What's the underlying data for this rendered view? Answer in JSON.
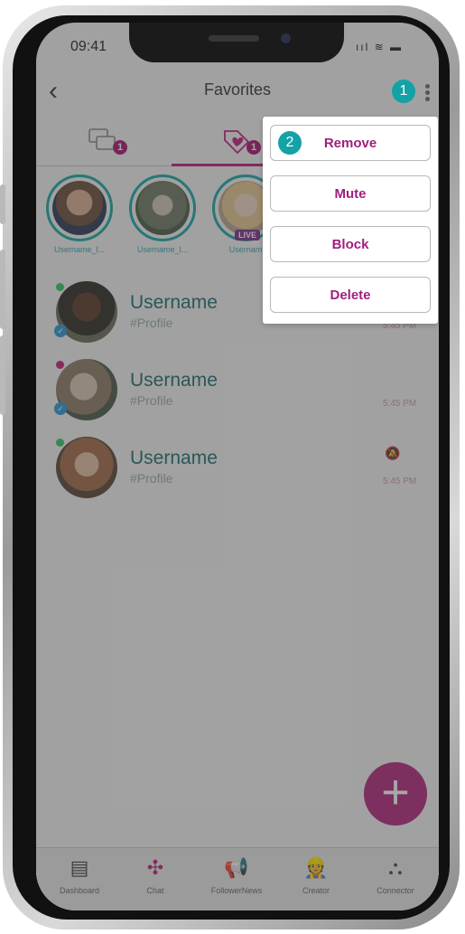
{
  "status_bar": {
    "time": "09:41",
    "icons": "ııl ≋ ▬"
  },
  "header": {
    "title": "Favorites",
    "back_icon": "‹"
  },
  "annotations": {
    "menu_marker": "1",
    "remove_marker": "2"
  },
  "tabs": {
    "chats_count": "1",
    "favorites_count": "1"
  },
  "stories": [
    {
      "label": "Username_l..."
    },
    {
      "label": "Username_l..."
    },
    {
      "label": "Usernam",
      "live": "LIVE"
    }
  ],
  "chats": [
    {
      "name": "Username",
      "handle": "#Profile",
      "time": "5:45 PM",
      "presence_color": "#33c76a"
    },
    {
      "name": "Username",
      "handle": "#Profile",
      "time": "5:45 PM",
      "presence_color": "#c41c7d"
    },
    {
      "name": "Username",
      "handle": "#Profile",
      "time": "5:45 PM",
      "presence_color": "#33c76a",
      "muted": true
    }
  ],
  "menu": {
    "remove": "Remove",
    "mute": "Mute",
    "block": "Block",
    "delete": "Delete"
  },
  "fab": {
    "icon": "+"
  },
  "bottom_nav": [
    {
      "label": "Dashboard",
      "icon": "dashboard-icon"
    },
    {
      "label": "Chat",
      "icon": "chat-network-icon"
    },
    {
      "label": "FollowerNews",
      "icon": "megaphone-icon"
    },
    {
      "label": "Creator",
      "icon": "creator-icon"
    },
    {
      "label": "Connector",
      "icon": "connector-icon"
    }
  ],
  "colors": {
    "accent": "#c41c7d",
    "teal": "#13a2a6",
    "fab": "#b3267f"
  }
}
